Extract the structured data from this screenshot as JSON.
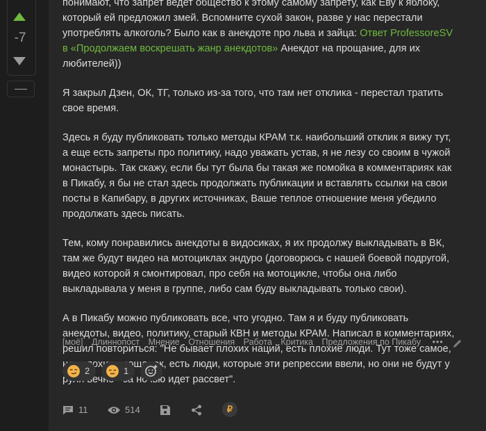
{
  "vote": {
    "count": "-7",
    "collapse": "—"
  },
  "post": {
    "paragraphs": [
      {
        "text": "понимают, что запрет ведет общество к этому самому запрету, как Еву к яблоку, который ей предложил змей. Вспомните сухой закон, разве у нас перестали употреблять алкоголь? Было как в анекдоте про льва и зайца: ",
        "link": "Ответ ProfessoreSV в «Продолжаем воскрешать жанр анекдотов»",
        "after": " Анекдот на прощание, для их любителей))"
      },
      {
        "text": "Я закрыл Дзен, ОК, ТГ, только из-за того, что там нет отклика - перестал тратить свое время."
      },
      {
        "text": "Здесь я буду публиковать только методы КРАМ т.к. наибольший отклик я вижу тут, а еще есть запреты про политику, надо уважать устав, я не лезу со своим в чужой монастырь. Так скажу, если бы тут была бы такая же помойка в комментариях как в Пикабу, я бы не стал здесь продолжать публикации и вставлять ссылки на свои посты в Капибару, в других источниках, Ваше теплое отношение меня убедило продолжать здесь писать."
      },
      {
        "text": "Тем, кому понравились анекдоты в видосиках, я их продолжу выкладывать в ВК, там же будут видео на мотоциклах эндуро (договорюсь с нашей боевой подругой, видео которой я смонтировал, про себя на мотоцикле, чтобы она либо выкладывала у меня в группе, либо сам буду выкладывать только свои)."
      },
      {
        "text": "А в Пикабу можно публиковать все, что угодно. Там я и буду публиковать анекдоты, видео, политику, старый КВН и методы КРАМ. Написал в комментариях, решил повториться: \"Не бывает плохих наций, есть плохие люди. Тут тоже самое, нет плохих площадок, есть люди, которые эти репрессии ввели, но они не будут у руля вечно - за ночью идет рассвет\"."
      }
    ]
  },
  "tags": [
    "[моё]",
    "Длиннопост",
    "Мнение",
    "Отношения",
    "Работа",
    "Критика",
    "Предложения по Пикабу"
  ],
  "tags_more": "•••",
  "reactions": [
    {
      "icon": "smirk-face-icon",
      "count": "2"
    },
    {
      "icon": "unamused-face-icon",
      "count": "1"
    }
  ],
  "footer": {
    "comments": "11",
    "views": "514",
    "donate_symbol": "₽"
  },
  "colors": {
    "accent": "#6fb93f",
    "background": "#1d1d1d",
    "card": "#272727",
    "muted": "#a0a0a0"
  }
}
